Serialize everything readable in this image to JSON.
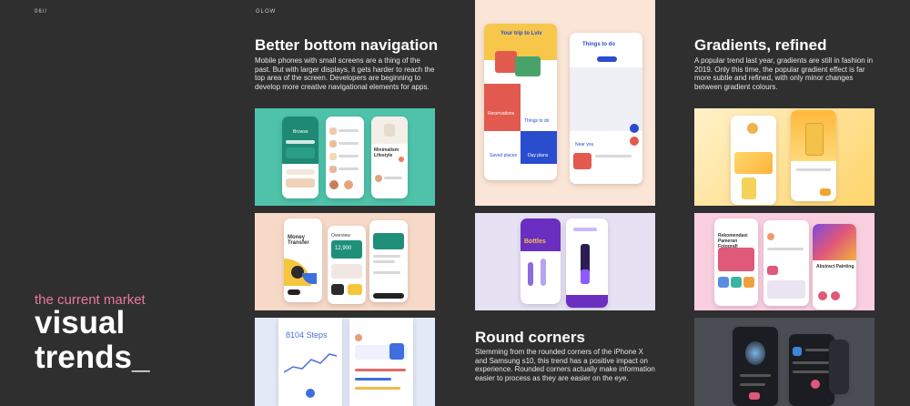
{
  "header": {
    "page_number": "06//",
    "brand": "GLOW"
  },
  "hero": {
    "subtitle": "the current market",
    "title_line1": "visual",
    "title_line2": "trends_"
  },
  "sections": {
    "bottom_nav": {
      "title": "Better bottom navigation",
      "body": "Mobile phones with small screens are a thing of the past. But with larger displays, it gets harder to reach the top area of the screen. Developers are beginning to develop more creative navigational elements for apps."
    },
    "gradients": {
      "title": "Gradients, refined",
      "body": "A popular trend last year, gradients are still in fashion in 2019. Only this time, the popular gradient effect is far more subtle and refined, with only minor changes between gradient colours."
    },
    "round_corners": {
      "title": "Round corners",
      "body": "Stemming from the rounded corners of the iPhone X and Samsung s10, this trend has a positive impact on experience. Rounded corners actually make information easier to process as they are easier on the eye."
    }
  },
  "mockups": {
    "browse": "Browse",
    "minimalism": "Minimalism Lifestyle",
    "money": "Money Transfer",
    "overview": "Overview",
    "amount": "12,900",
    "stats": "8104 Steps",
    "trip": "Your trip to Lviv",
    "things": "Things to do",
    "reservations": "Reservations",
    "saved": "Saved places",
    "day": "Day plans",
    "near": "Near you",
    "bottles": "Bottles",
    "rekomendasi": "Rekomendasi Pameran Fotografi",
    "abstract": "Abstract Painting"
  },
  "colors": {
    "accent_pink": "#e8799a",
    "background": "#2f2f2f"
  }
}
